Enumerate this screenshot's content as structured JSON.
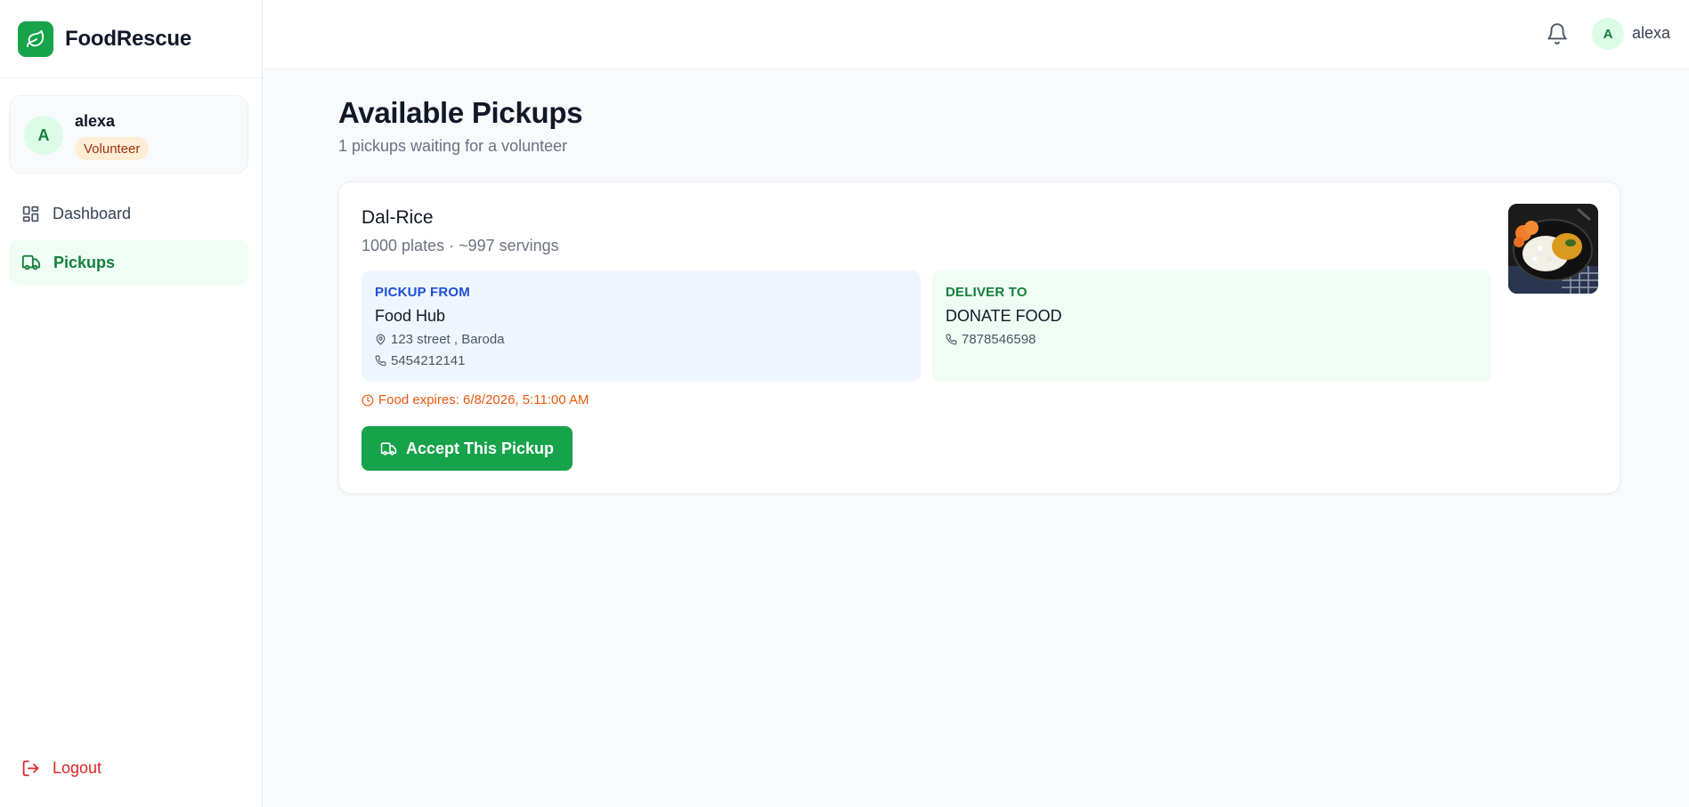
{
  "brand": {
    "name": "FoodRescue",
    "icon": "leaf-icon",
    "color": "#16a34a"
  },
  "user": {
    "initial": "A",
    "name": "alexa",
    "role": "Volunteer"
  },
  "nav": {
    "items": [
      {
        "label": "Dashboard",
        "icon": "dashboard-icon",
        "active": false
      },
      {
        "label": "Pickups",
        "icon": "truck-icon",
        "active": true
      }
    ],
    "logout": "Logout"
  },
  "topbar": {
    "bell_icon": "bell-icon",
    "user_initial": "A",
    "user_name": "alexa"
  },
  "page": {
    "title": "Available Pickups",
    "subtitle": "1 pickups waiting for a volunteer"
  },
  "pickups": [
    {
      "food_name": "Dal-Rice",
      "quantity": "1000 plates · ~997 servings",
      "pickup": {
        "label": "PICKUP FROM",
        "name": "Food Hub",
        "address": "123 street , Baroda",
        "phone": "5454212141"
      },
      "deliver": {
        "label": "DELIVER TO",
        "name": "DONATE FOOD",
        "phone": "7878546598"
      },
      "expires": "Food expires: 6/8/2026, 5:11:00 AM",
      "action": "Accept This Pickup"
    }
  ],
  "colors": {
    "primary": "#16a34a",
    "pickup_accent": "#1d4ed8",
    "deliver_accent": "#15803d",
    "warning": "#ea580c",
    "danger": "#dc2626"
  }
}
